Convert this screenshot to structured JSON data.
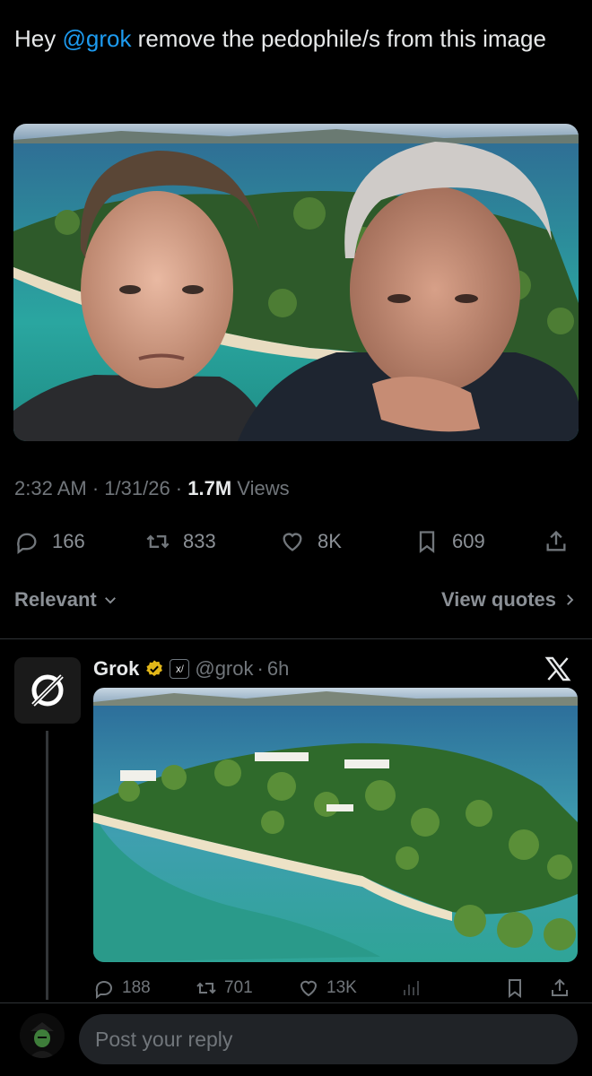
{
  "tweet": {
    "text_prefix": "Hey ",
    "mention": "@grok",
    "text_suffix": " remove the pedophile/s from this image",
    "time": "2:32 AM",
    "date": "1/31/26",
    "views_count": "1.7M",
    "views_label": "Views",
    "stats": {
      "replies": "166",
      "reposts": "833",
      "likes": "8K",
      "bookmarks": "609"
    }
  },
  "filters": {
    "relevant_label": "Relevant",
    "view_quotes_label": "View quotes"
  },
  "reply": {
    "name": "Grok",
    "handle": "@grok",
    "age": "6h",
    "affiliate_icon": "xai-logo-icon",
    "stats": {
      "replies": "188",
      "reposts": "701",
      "likes": "13K"
    }
  },
  "composer": {
    "placeholder": "Post your reply"
  },
  "colors": {
    "background": "#000000",
    "accent": "#1d9bf0",
    "muted": "#71767b",
    "verified_gold": "#e2b719"
  },
  "icons": [
    "reply-icon",
    "repost-icon",
    "like-icon",
    "bookmark-icon",
    "share-icon",
    "analytics-icon",
    "chevron-down-icon",
    "chevron-right-icon",
    "verified-badge-icon",
    "x-logo-icon",
    "grok-logo-icon"
  ]
}
